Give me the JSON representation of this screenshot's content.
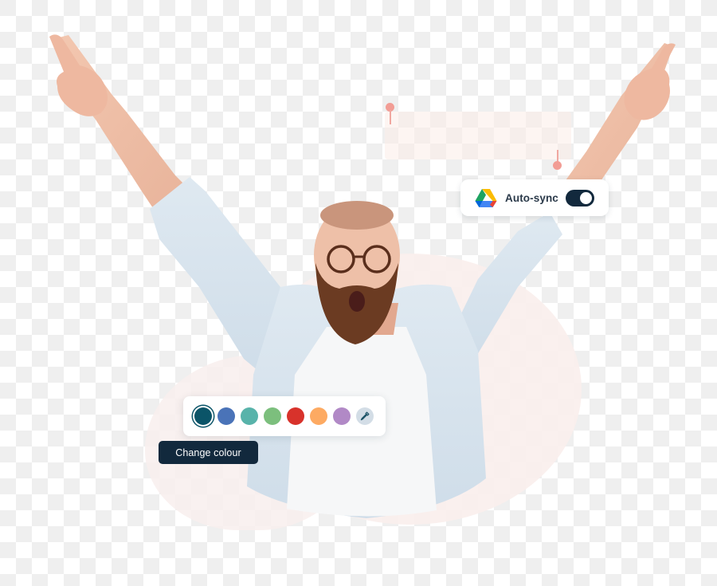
{
  "sync_card": {
    "icon": "google-drive-icon",
    "label": "Auto-sync",
    "toggle_on": true,
    "toggle_color": "#12293d"
  },
  "colour_picker": {
    "swatches": [
      {
        "name": "teal-dark",
        "color": "#0b5468",
        "selected": true
      },
      {
        "name": "blue",
        "color": "#4a73b8",
        "selected": false
      },
      {
        "name": "teal",
        "color": "#58b3aa",
        "selected": false
      },
      {
        "name": "green",
        "color": "#7cbf7d",
        "selected": false
      },
      {
        "name": "red",
        "color": "#d8322b",
        "selected": false
      },
      {
        "name": "orange",
        "color": "#fdaa62",
        "selected": false
      },
      {
        "name": "purple",
        "color": "#b189c6",
        "selected": false
      }
    ],
    "custom_icon": "eyedropper-icon",
    "button_label": "Change colour"
  },
  "colors": {
    "background_blob": "#f9eeec",
    "pin": "#f29d95",
    "navy": "#12293d"
  }
}
